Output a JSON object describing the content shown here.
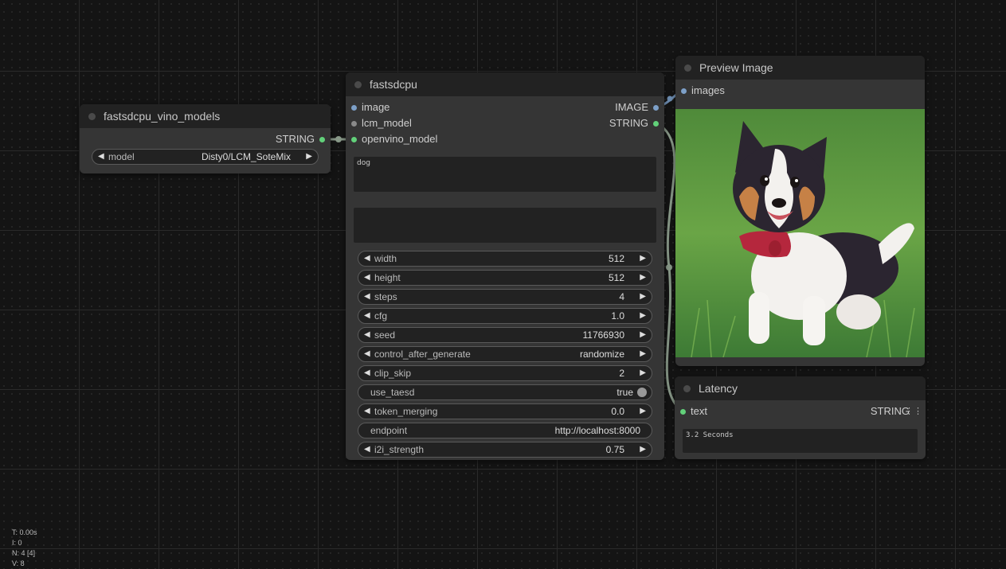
{
  "nodes": {
    "models": {
      "title": "fastsdcpu_vino_models",
      "output": "STRING",
      "widget_label": "model",
      "widget_value": "Disty0/LCM_SoteMix"
    },
    "fastsdcpu": {
      "title": "fastsdcpu",
      "inputs": [
        "image",
        "lcm_model",
        "openvino_model"
      ],
      "outputs": [
        "IMAGE",
        "STRING"
      ],
      "prompt": "dog",
      "negative_prompt": "",
      "widgets": [
        {
          "label": "width",
          "value": "512"
        },
        {
          "label": "height",
          "value": "512"
        },
        {
          "label": "steps",
          "value": "4"
        },
        {
          "label": "cfg",
          "value": "1.0"
        },
        {
          "label": "seed",
          "value": "11766930"
        },
        {
          "label": "control_after_generate",
          "value": "randomize"
        },
        {
          "label": "clip_skip",
          "value": "2"
        },
        {
          "label": "use_taesd",
          "value": "true"
        },
        {
          "label": "token_merging",
          "value": "0.0"
        },
        {
          "label": "endpoint",
          "value": "http://localhost:8000"
        },
        {
          "label": "i2i_strength",
          "value": "0.75"
        }
      ]
    },
    "preview": {
      "title": "Preview Image",
      "input": "images",
      "image_alt": "Illustrated tricolor puppy with red collar sitting in grass"
    },
    "latency": {
      "title": "Latency",
      "input": "text",
      "output": "STRING",
      "text": "3.2 Seconds"
    }
  },
  "stats": {
    "t": "T: 0.00s",
    "i": "I: 0",
    "n": "N: 4 [4]",
    "v": "V: 8"
  },
  "colors": {
    "pin_image": "#7da0c8",
    "pin_string": "#62d17a",
    "pin_model": "#8a8a8a",
    "node_bg": "#353535",
    "title_bg": "#222222",
    "canvas": "#141414"
  }
}
